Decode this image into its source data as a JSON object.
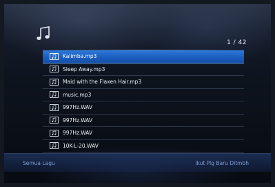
{
  "header": {
    "icon": "music-note-icon",
    "page_indicator": "1 / 42"
  },
  "files": [
    {
      "name": "Kalimba.mp3",
      "selected": true
    },
    {
      "name": "Sleep Away.mp3",
      "selected": false
    },
    {
      "name": "Maid with the Flaxen Hair.mp3",
      "selected": false
    },
    {
      "name": "music.mp3",
      "selected": false
    },
    {
      "name": "997Hz.WAV",
      "selected": false
    },
    {
      "name": "997Hz.WAV",
      "selected": false
    },
    {
      "name": "997Hz.WAV",
      "selected": false
    },
    {
      "name": "10K-L-20.WAV",
      "selected": false
    }
  ],
  "footer": {
    "left_label": "Semua Lagu",
    "right_label": "Ikut Plg Baru Ditmbh"
  },
  "colors": {
    "selection": "#1a5ec0",
    "footer_text": "#7f9ed6",
    "text": "#e9edf4"
  }
}
